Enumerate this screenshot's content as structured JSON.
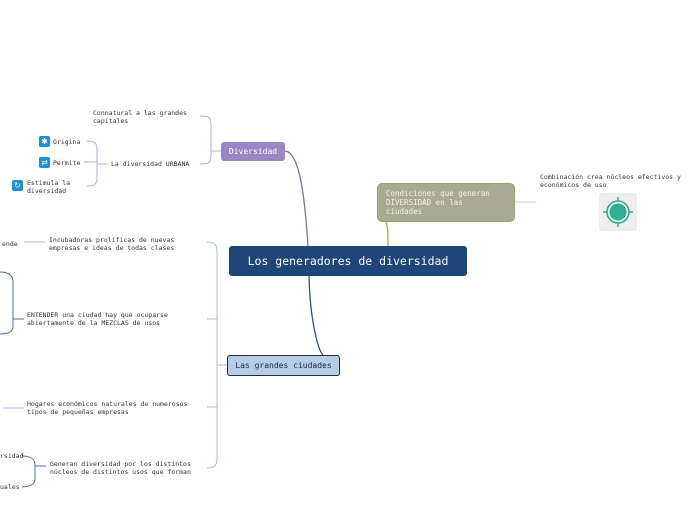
{
  "central": {
    "title": "Los generadores de diversidad"
  },
  "diversidad": {
    "label": "Diversidad",
    "children": {
      "connatural": "Connatural a las grandes\ncapitales",
      "urbana": "La diversidad URBANA",
      "origina": "Origina",
      "permite": "Permite",
      "estimula": "Estimula la\ndiversidad"
    }
  },
  "condiciones": {
    "label": "Condiciones que generan\nDIVERSIDAD en las\nciudades",
    "note": "Combinación crea núcleos efectivos y\neconómicos de uso",
    "icon": "target-icon",
    "icon_color": "#2fae92"
  },
  "grandes": {
    "label": "Las grandes ciudades",
    "children": {
      "incubadoras": "Incubadoras prolíficas de nuevas\nempresas e ideas de todas clases",
      "ende": "ende",
      "entender": "ENTENDER una ciudad hay que ocuparse\nabiertamente de la MEZCLAS de usos",
      "hogares": "Hogares económicos naturales de numerosos\ntipos de pequeñas empresas",
      "generan": "Generan diversidad por los distintos\nnúcleos de distintos usos que forman",
      "rsidad": "rsidad",
      "uales": "uales"
    }
  },
  "colors": {
    "central": "#1f4579",
    "diversidad": "#9b86c4",
    "condiciones": "#aaa993",
    "grandes": "#b8cce8"
  }
}
